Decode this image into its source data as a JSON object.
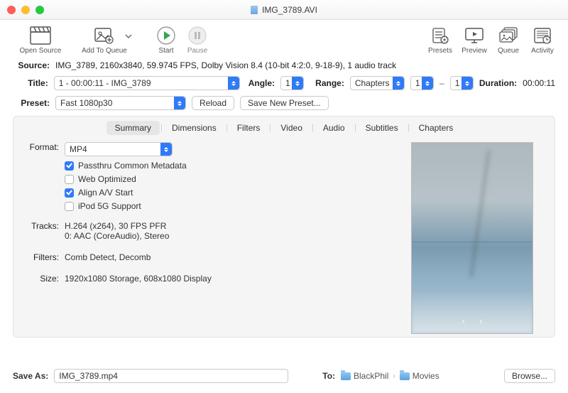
{
  "window": {
    "title": "IMG_3789.AVI"
  },
  "toolbar": {
    "open_source": "Open Source",
    "add_to_queue": "Add To Queue",
    "start": "Start",
    "pause": "Pause",
    "presets": "Presets",
    "preview": "Preview",
    "queue": "Queue",
    "activity": "Activity"
  },
  "source": {
    "label": "Source:",
    "value": "IMG_3789, 2160x3840, 59.9745 FPS, Dolby Vision 8.4 (10-bit 4:2:0, 9-18-9), 1 audio track"
  },
  "title_row": {
    "label": "Title:",
    "value": "1 - 00:00:11 - IMG_3789"
  },
  "angle": {
    "label": "Angle:",
    "value": "1"
  },
  "range": {
    "label": "Range:",
    "type": "Chapters",
    "from": "1",
    "to": "1"
  },
  "duration": {
    "label": "Duration:",
    "value": "00:00:11"
  },
  "preset": {
    "label": "Preset:",
    "value": "Fast 1080p30",
    "reload": "Reload",
    "save_new": "Save New Preset..."
  },
  "tabs": [
    "Summary",
    "Dimensions",
    "Filters",
    "Video",
    "Audio",
    "Subtitles",
    "Chapters"
  ],
  "summary": {
    "format_label": "Format:",
    "format_value": "MP4",
    "checks": {
      "passthru": "Passthru Common Metadata",
      "web": "Web Optimized",
      "align": "Align A/V Start",
      "ipod": "iPod 5G Support"
    },
    "tracks_label": "Tracks:",
    "tracks_line1": "H.264 (x264), 30 FPS PFR",
    "tracks_line2": "0: AAC (CoreAudio), Stereo",
    "filters_label": "Filters:",
    "filters_value": "Comb Detect, Decomb",
    "size_label": "Size:",
    "size_value": "1920x1080 Storage, 608x1080 Display"
  },
  "save": {
    "label": "Save As:",
    "value": "IMG_3789.mp4",
    "to_label": "To:",
    "path1": "BlackPhil",
    "path2": "Movies",
    "browse": "Browse..."
  }
}
